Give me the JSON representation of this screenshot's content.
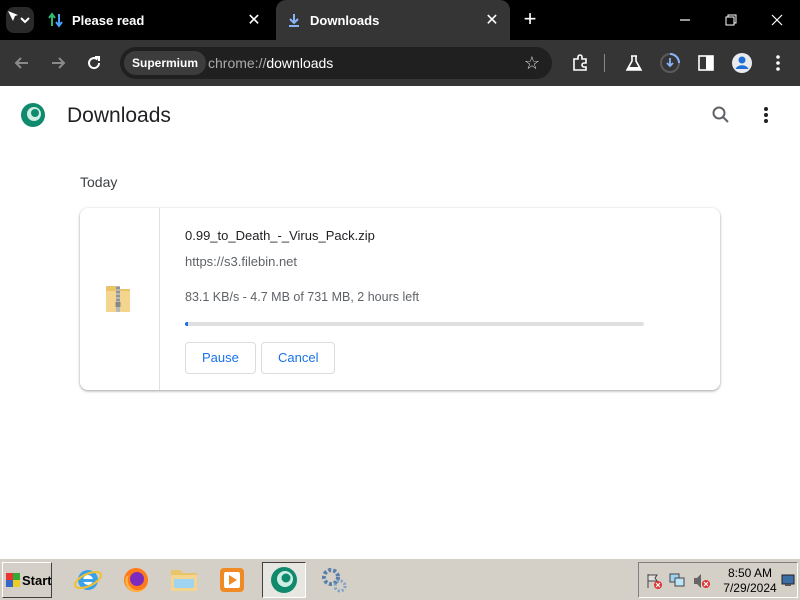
{
  "tabs": [
    {
      "title": "Please read",
      "icon": "transfer-arrows-icon"
    },
    {
      "title": "Downloads",
      "icon": "download-icon",
      "active": true
    }
  ],
  "toolbar": {
    "site_chip": "Supermium",
    "url_scheme": "chrome://",
    "url_host": "downloads"
  },
  "page": {
    "title": "Downloads",
    "section_label": "Today",
    "download": {
      "filename": "0.99_to_Death_-_Virus_Pack.zip",
      "source": "https://s3.filebin.net",
      "status": "83.1 KB/s - 4.7 MB of 731 MB, 2 hours left",
      "progress_fraction": 0.0064,
      "pause_label": "Pause",
      "cancel_label": "Cancel"
    }
  },
  "taskbar": {
    "start_label": "Start",
    "apps": [
      "internet-explorer-icon",
      "firefox-icon",
      "file-explorer-icon",
      "media-player-icon",
      "supermium-icon",
      "settings-gears-icon"
    ],
    "time": "8:50 AM",
    "date": "7/29/2024"
  },
  "colors": {
    "accent": "#1a73e8",
    "tabstrip": "#000000",
    "toolbar": "#353535",
    "taskbar": "#d4d0c8"
  }
}
